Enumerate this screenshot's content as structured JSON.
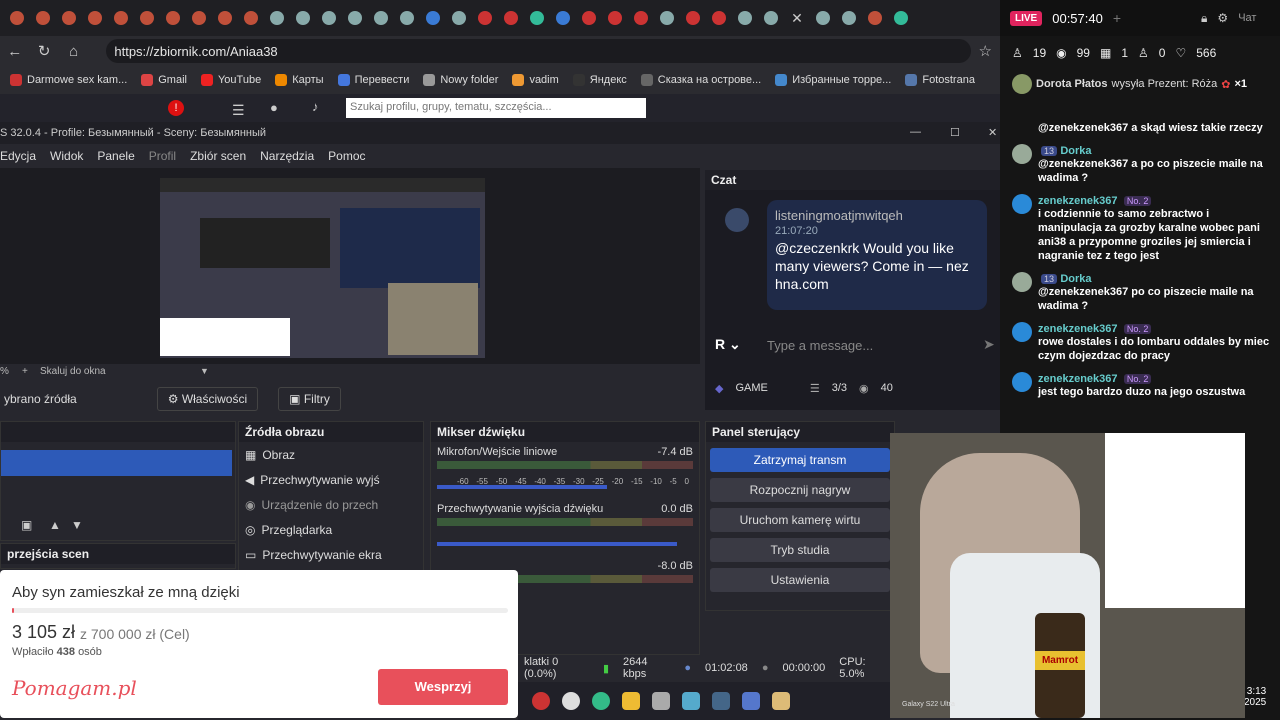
{
  "browser": {
    "url": "https://zbiornik.com/Aniaa38",
    "bookmarks": [
      "Darmowe sex kam...",
      "Gmail",
      "YouTube",
      "Карты",
      "Перевести",
      "Nowy folder",
      "vadim",
      "Яндекс",
      "Сказка на острове...",
      "Избранные торре...",
      "Fotostrana"
    ],
    "site_search_placeholder": "Szukaj profilu, grupy, tematu, szczęścia..."
  },
  "obs": {
    "title": "S 32.0.4 - Profile: Безымянный - Sceny: Безымянный",
    "menu": [
      "Edycja",
      "Widok",
      "Panele",
      "Profil",
      "Zbiór scen",
      "Narzędzia",
      "Pomoc"
    ],
    "zoom_label": "Skaluj do okna",
    "zoom_prefix": "%",
    "source_toolbar": {
      "label": "ybrano źródła",
      "properties": "Właściwości",
      "filters": "Filtry"
    },
    "sources_title": "Źródła obrazu",
    "sources": [
      "Obraz",
      "Przechwytywanie wyjś",
      "Urządzenie do przech",
      "Przeglądarka",
      "Przechwytywanie ekra"
    ],
    "transitions_title": "przejścia scen",
    "mixer_title": "Mikser dźwięku",
    "mixer": [
      {
        "name": "Mikrofon/Wejście liniowe",
        "db": "-7.4 dB"
      },
      {
        "name": "Przechwytywanie wyjścia dźwięku",
        "db": "0.0 dB"
      },
      {
        "name": "",
        "db": "-8.0 dB"
      }
    ],
    "scale_ticks": [
      "-60",
      "-55",
      "-50",
      "-45",
      "-40",
      "-35",
      "-30",
      "-25",
      "-20",
      "-15",
      "-10",
      "-5",
      "0"
    ],
    "controls_title": "Panel sterujący",
    "controls": [
      "Zatrzymaj transm",
      "Rozpocznij nagryw",
      "Uruchom kamerę wirtu",
      "Tryb studia",
      "Ustawienia"
    ],
    "status": {
      "frames": "klatki 0 (0.0%)",
      "bitrate": "2644 kbps",
      "stream_time": "01:02:08",
      "rec_time": "00:00:00",
      "cpu": "CPU: 5.0%"
    }
  },
  "chat_dock": {
    "title": "Czat",
    "username": "listeningmoatjmwitqeh",
    "time": "21:07:20",
    "message": "@czeczenkrk Would you like many viewers? Come in — nez hna.com",
    "input_placeholder": "Type a message...",
    "game_label": "GAME",
    "slots": "3/3",
    "viewers": "40"
  },
  "donation": {
    "title": "Aby syn zamieszkał ze mną dzięki",
    "amount": "3 105 zł",
    "goal": "z 700 000 zł (Cel)",
    "payers_prefix": "Wpłaciło",
    "payers_count": "438",
    "payers_suffix": "osób",
    "brand": "Pomagam.pl",
    "button": "Wesprzyj",
    "progress": 0.004
  },
  "stream_panel": {
    "live_label": "LIVE",
    "timer": "00:57:40",
    "chat_label": "Чат",
    "stats": {
      "followers": "19",
      "views": "99",
      "gifts": "1",
      "friends": "0",
      "likes": "566"
    },
    "gift_line": {
      "user": "Dorota Płatos",
      "text": "wysyła Prezent: Róża",
      "count": "×1"
    },
    "messages": [
      {
        "user": "",
        "level": "",
        "text": "@zenekzenek367 a skąd wiesz takie rzeczy"
      },
      {
        "user": "Dorka",
        "level": "13",
        "text": "@zenekzenek367 a po co piszecie maile na wadima ?"
      },
      {
        "user": "zenekzenek367",
        "level": "No. 2",
        "text": "i codziennie to samo zebractwo i manipulacja za grozby karalne wobec pani ani38 a przypomne groziles jej smiercia i nagranie tez z tego jest"
      },
      {
        "user": "Dorka",
        "level": "13",
        "text": "@zenekzenek367 po co piszecie maile na wadima ?"
      },
      {
        "user": "zenekzenek367",
        "level": "No. 2",
        "text": "rowe dostales i do lombaru oddales by miec czym dojezdzac do pracy"
      },
      {
        "user": "zenekzenek367",
        "level": "No. 2",
        "text": "jest tego bardzo duzo na jego oszustwa"
      }
    ],
    "clock_time": "3:13",
    "clock_year": "2025"
  },
  "camera": {
    "watermark": "Galaxy S22 Ultra",
    "bottle_label": "Mamrot"
  },
  "colors": {
    "accent": "#2d5ab8",
    "live": "#e0245e",
    "donate": "#e8505b"
  }
}
